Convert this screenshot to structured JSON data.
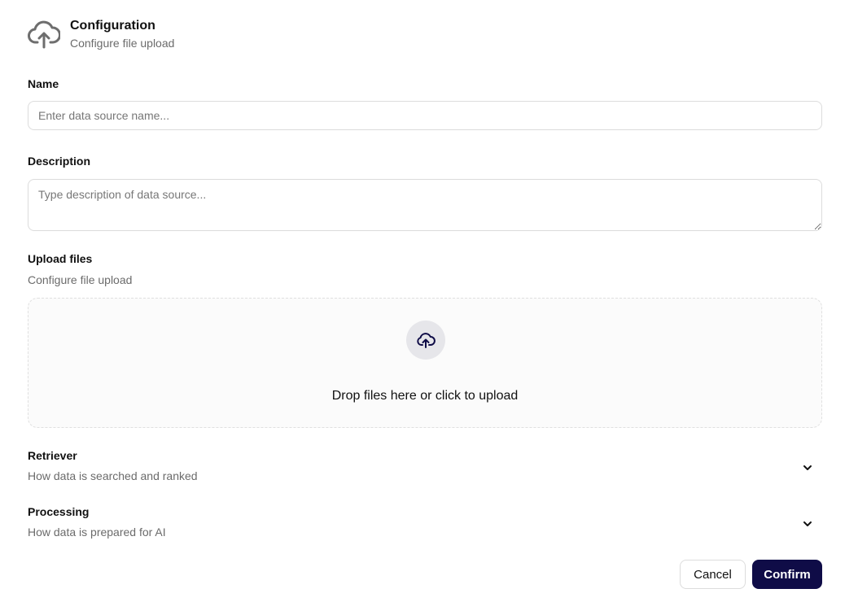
{
  "header": {
    "title": "Configuration",
    "subtitle": "Configure file upload",
    "icon": "cloud-upload-icon"
  },
  "name_field": {
    "label": "Name",
    "placeholder": "Enter data source name...",
    "value": ""
  },
  "description_field": {
    "label": "Description",
    "placeholder": "Type description of data source...",
    "value": ""
  },
  "upload": {
    "label": "Upload files",
    "sublabel": "Configure file upload",
    "dropzone_text": "Drop files here or click to upload",
    "icon": "cloud-upload-icon"
  },
  "sections": [
    {
      "title": "Retriever",
      "subtitle": "How data is searched and ranked"
    },
    {
      "title": "Processing",
      "subtitle": "How data is prepared for AI"
    }
  ],
  "actions": {
    "cancel_label": "Cancel",
    "confirm_label": "Confirm"
  },
  "colors": {
    "accent": "#0f0c47",
    "muted_text": "#6b6b6b",
    "icon_gray": "#6e6e6e",
    "border": "#dcdcdc"
  }
}
